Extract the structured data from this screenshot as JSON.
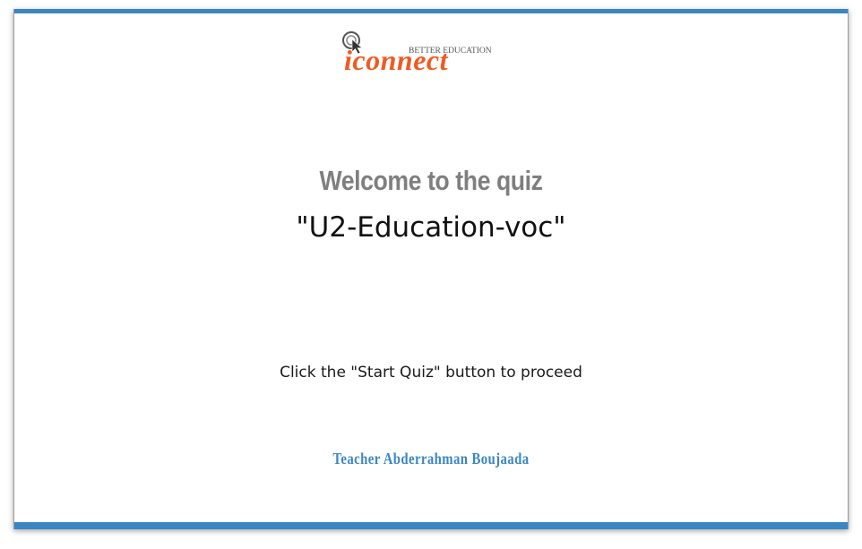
{
  "logo": {
    "brand_text": "iconnect",
    "tagline": "BETTER EDUCATION",
    "brand_color": "#f15a22",
    "icon": "cursor-click-icon"
  },
  "colors": {
    "accent": "#3a86c4",
    "welcome_text": "#7f7f7f"
  },
  "quiz": {
    "welcome": "Welcome to the quiz",
    "name": "\"U2-Education-voc\"",
    "instruction": "Click the \"Start Quiz\" button to proceed"
  },
  "footer": {
    "teacher": "Teacher Abderrahman Boujaada"
  }
}
